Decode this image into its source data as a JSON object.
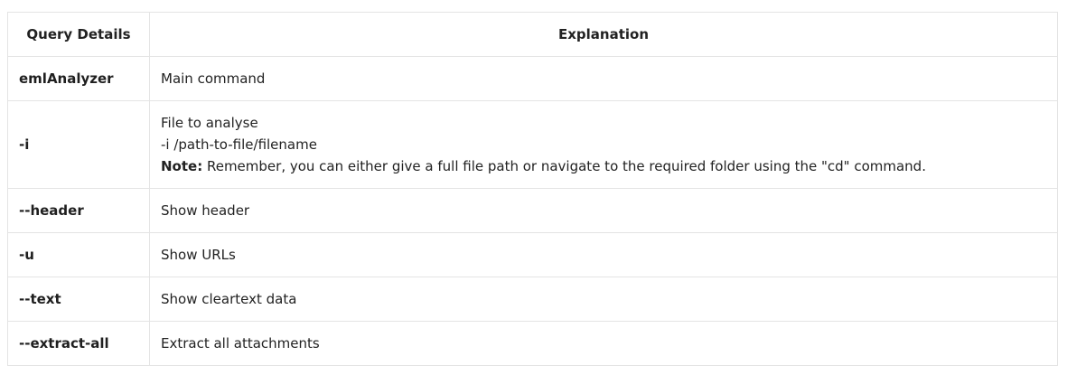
{
  "table": {
    "headers": [
      "Query Details",
      "Explanation"
    ],
    "rows": [
      {
        "option": "emlAnalyzer",
        "lines": [
          "Main command"
        ]
      },
      {
        "option": "-i",
        "lines": [
          "File to analyse",
          "-i /path-to-file/filename"
        ],
        "note_label": "Note:",
        "note_text": " Remember, you can either give a full file path or navigate to the required folder using the \"cd\" command."
      },
      {
        "option": "--header",
        "lines": [
          "Show header"
        ]
      },
      {
        "option": "-u",
        "lines": [
          "Show URLs"
        ]
      },
      {
        "option": "--text",
        "lines": [
          "Show cleartext data"
        ]
      },
      {
        "option": "--extract-all",
        "lines": [
          "Extract all attachments"
        ]
      }
    ]
  }
}
